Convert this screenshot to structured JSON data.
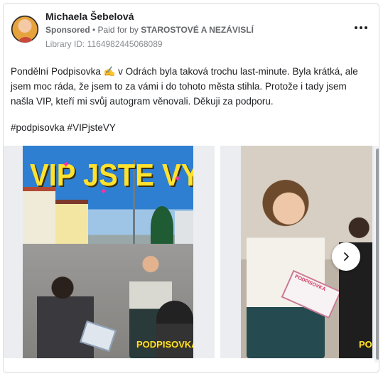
{
  "post": {
    "page_name": "Michaela Šebelová",
    "sponsored_label": "Sponsored",
    "separator": " • ",
    "paid_for_prefix": "Paid for by ",
    "paid_for_by": "STAROSTOVÉ A NEZÁVISLÍ",
    "library_id": "Library ID: 1164982445068089",
    "more_icon": "more-horizontal-icon",
    "text_lines": [
      "Pondělní Podpisovka ✍️  v Odrách byla taková trochu last-minute. Byla krátká, ale",
      "jsem moc ráda, že jsem to za vámi i do tohoto města stihla. Protože i tady jsem",
      "našla VIP, kteří mi svůj autogram věnovali. Děkuji za podporu."
    ],
    "hashtags": "#podpisovka #VIPjsteVY"
  },
  "carousel": {
    "slides": [
      {
        "overlay_title": "VIP JSTE VY!",
        "brand_tag": "PODPISOVKA"
      },
      {
        "clipboard_label": "PODPISOVKA",
        "brand_tag": "PODPIS"
      }
    ],
    "next_icon": "chevron-right-icon"
  },
  "colors": {
    "overlay_yellow": "#ffe22e",
    "sparkle_pink": "#ff2fa4",
    "muted_text": "#65676b"
  }
}
